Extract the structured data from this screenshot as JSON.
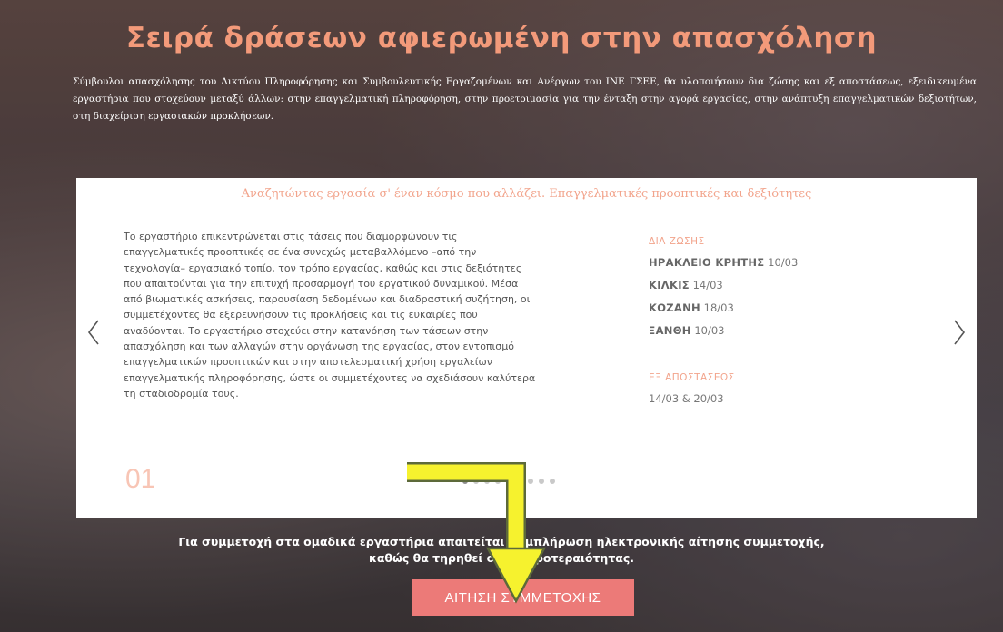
{
  "page": {
    "title": "Σειρά δράσεων αφιερωμένη στην απασχόληση",
    "intro": "Σύμβουλοι απασχόλησης του Δικτύου Πληροφόρησης και Συμβουλευτικής Εργαζομένων και Ανέργων του ΙΝΕ ΓΣΕΕ, θα υλοποιήσουν δια ζώσης και εξ αποστάσεως, εξειδικευμένα εργαστήρια που στοχεύουν μεταξύ άλλων: στην επαγγελματική πληροφόρηση, στην προετοιμασία για την ένταξη στην αγορά εργασίας, στην ανάπτυξη επαγγελματικών δεξιοτήτων, στη διαχείριση εργασιακών προκλήσεων."
  },
  "slide": {
    "title": "Αναζητώντας εργασία σ' έναν κόσμο που αλλάζει. Επαγγελματικές προοπτικές και δεξιότητες",
    "description": "Το εργαστήριο επικεντρώνεται στις τάσεις που διαμορφώνουν τις επαγγελματικές προοπτικές σε ένα συνεχώς μεταβαλλόμενο –από την τεχνολογία– εργασιακό τοπίο, τον τρόπο εργασίας, καθώς και στις δεξιότητες που απαιτούνται για την επιτυχή προσαρμογή του εργατικού δυναμικού. Μέσα από βιωματικές ασκήσεις, παρουσίαση δεδομένων και διαδραστική συζήτηση, οι συμμετέχοντες θα εξερευνήσουν τις προκλήσεις και τις ευκαιρίες που αναδύονται. Το εργαστήριο στοχεύει στην κατανόηση των τάσεων στην απασχόληση και των αλλαγών στην οργάνωση της εργασίας, στον εντοπισμό επαγγελματικών προοπτικών και στην αποτελεσματική χρήση εργαλείων επαγγελματικής πληροφόρησης, ώστε οι συμμετέχοντες να σχεδιάσουν καλύτερα τη σταδιοδρομία τους.",
    "in_person_heading": "ΔΙΑ ΖΩΣΗΣ",
    "sessions": [
      {
        "city": "ΗΡΑΚΛΕΙΟ ΚΡΗΤΗΣ",
        "date": "10/03"
      },
      {
        "city": "ΚΙΛΚΙΣ",
        "date": "14/03"
      },
      {
        "city": "ΚΟΖΑΝΗ",
        "date": "18/03"
      },
      {
        "city": "ΞΑΝΘΗ",
        "date": "10/03"
      }
    ],
    "remote_heading": "ΕΞ ΑΠΟΣΤΑΣΕΩΣ",
    "remote_dates": "14/03 & 20/03",
    "number": "01"
  },
  "carousel": {
    "dot_count": 9,
    "active_index": 0
  },
  "note": {
    "line1": "Για συμμετοχή στα ομαδικά εργαστήρια απαιτείται συμπλήρωση ηλεκτρονικής αίτησης συμμετοχής,",
    "line2": "καθώς θα τηρηθεί σειρά προτεραιότητας."
  },
  "cta": {
    "label": "ΑΙΤΗΣΗ ΣΥΜΜΕΤΟΧΗΣ"
  },
  "colors": {
    "accent": "#f39a7a",
    "button": "#ec7a78",
    "annotation_arrow": "#f6f22e"
  },
  "icons": {
    "prev": "chevron-left-icon",
    "next": "chevron-right-icon"
  }
}
